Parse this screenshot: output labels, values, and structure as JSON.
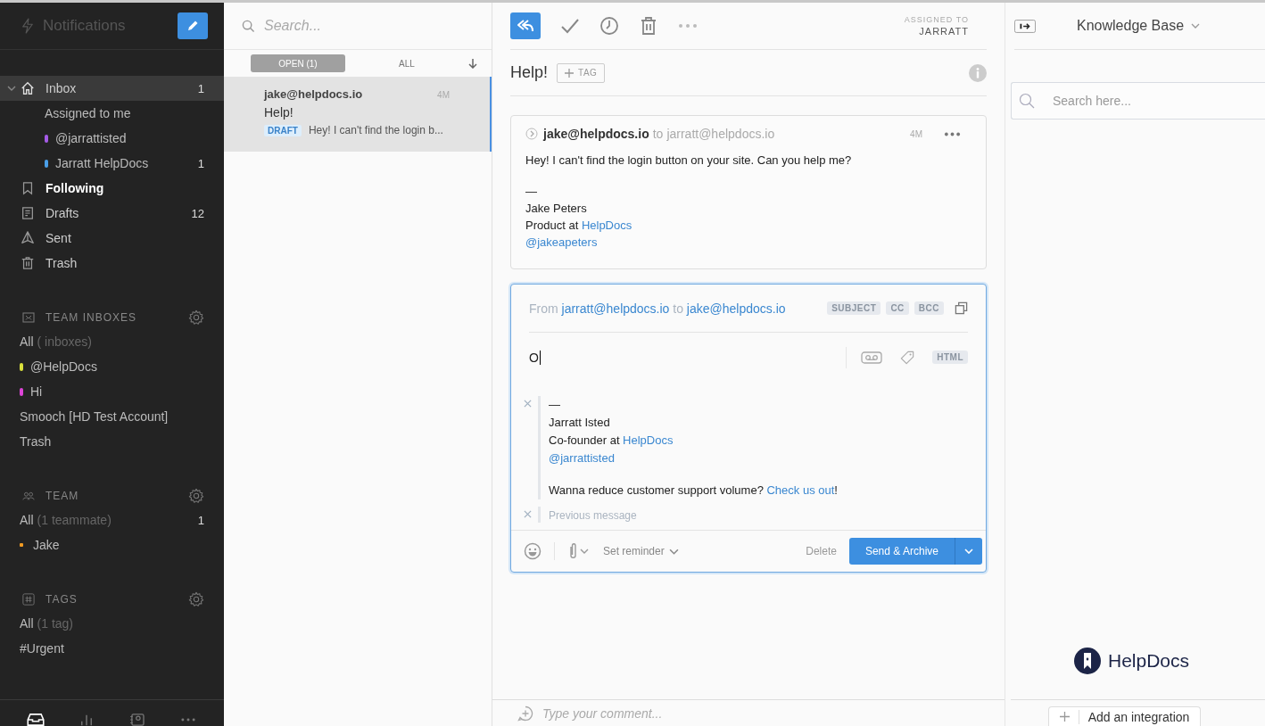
{
  "sidebar": {
    "title": "Notifications",
    "nav": [
      {
        "kind": "inbox",
        "label": "Inbox",
        "count": "1",
        "expanded": true,
        "selected": true,
        "bold": false,
        "children": [
          {
            "label": "Assigned to me",
            "selected": false
          },
          {
            "label": "@jarrattisted",
            "color": "#a45be6",
            "selected": false
          },
          {
            "label": "Jarratt HelpDocs",
            "color": "#4a9fe8",
            "count": "1",
            "selected": false
          }
        ]
      },
      {
        "kind": "following",
        "label": "Following",
        "selected": false,
        "bold": true
      },
      {
        "kind": "drafts",
        "label": "Drafts",
        "count": "12",
        "selected": false,
        "bold": false
      },
      {
        "kind": "sent",
        "label": "Sent",
        "selected": false,
        "bold": false
      },
      {
        "kind": "trash",
        "label": "Trash",
        "selected": false,
        "bold": false
      }
    ],
    "sections": [
      {
        "kind": "inboxes",
        "title": "TEAM INBOXES",
        "items": [
          {
            "label": "All",
            "note": "( inboxes)"
          },
          {
            "label": "@HelpDocs",
            "color": "#d9e03c"
          },
          {
            "label": "Hi",
            "color": "#dc44d6"
          },
          {
            "label": "Smooch [HD Test Account]"
          },
          {
            "label": "Trash"
          }
        ]
      },
      {
        "kind": "team",
        "title": "TEAM",
        "items": [
          {
            "label": "All",
            "note": "(1 teammate)",
            "count": "1"
          },
          {
            "label": "Jake",
            "color": "#f09a22"
          }
        ]
      },
      {
        "kind": "tags",
        "title": "TAGS",
        "items": [
          {
            "label": "All",
            "note": "(1 tag)"
          },
          {
            "label": "#Urgent"
          }
        ]
      }
    ],
    "bottom_nav": [
      {
        "kind": "inbox",
        "selected": true
      },
      {
        "kind": "stats",
        "selected": false
      },
      {
        "kind": "contacts",
        "selected": false
      },
      {
        "kind": "more",
        "selected": false
      }
    ]
  },
  "list": {
    "search_placeholder": "Search...",
    "filters": [
      {
        "label": "OPEN (1)",
        "selected": true
      },
      {
        "label": "ALL",
        "selected": false
      }
    ],
    "conversations": [
      {
        "from": "jake@helpdocs.io",
        "time": "4M",
        "subject": "Help!",
        "tag": "DRAFT",
        "preview": "Hey! I can't find the login b...",
        "selected": true
      }
    ]
  },
  "conversation": {
    "assigned_label": "ASSIGNED TO",
    "assigned_to": "JARRATT",
    "title": "Help!",
    "tag_button": "TAG",
    "message": {
      "from": "jake@helpdocs.io",
      "to_word": "to",
      "to": "jarratt@helpdocs.io",
      "time": "4M",
      "paragraphs": [
        [
          [
            {
              "text": "Hey! I can't find the login button on your site. Can you help me?",
              "link": false
            }
          ]
        ],
        [
          [
            {
              "text": "—",
              "link": false
            }
          ],
          [
            {
              "text": "Jake Peters",
              "link": false
            }
          ],
          [
            {
              "text": "Product at ",
              "link": false
            },
            {
              "text": "HelpDocs",
              "link": true
            }
          ],
          [
            {
              "text": "@jakeapeters",
              "link": true
            }
          ]
        ]
      ]
    },
    "composer": {
      "from_word": "From",
      "from": "jarratt@helpdocs.io",
      "to_word": "to",
      "to": "jake@helpdocs.io",
      "chips": [
        "SUBJECT",
        "CC",
        "BCC"
      ],
      "text": "O",
      "format_chip": "HTML",
      "signature": [
        [
          [
            {
              "text": "—",
              "link": false
            }
          ],
          [
            {
              "text": "Jarratt Isted",
              "link": false
            }
          ],
          [
            {
              "text": "Co-founder at ",
              "link": false
            },
            {
              "text": "HelpDocs",
              "link": true
            }
          ],
          [
            {
              "text": "@jarrattisted",
              "link": true
            }
          ]
        ],
        [
          [
            {
              "text": "Wanna reduce customer support volume? ",
              "link": false
            },
            {
              "text": "Check us out",
              "link": true
            },
            {
              "text": "!",
              "link": false
            }
          ]
        ]
      ],
      "previous": "Previous message",
      "reminder": "Set reminder",
      "delete": "Delete",
      "send": "Send & Archive"
    },
    "comment_placeholder": "Type your comment..."
  },
  "right_panel": {
    "title": "Knowledge Base",
    "search_placeholder": "Search here...",
    "logo": "HelpDocs",
    "add_button": "Add an integration"
  }
}
